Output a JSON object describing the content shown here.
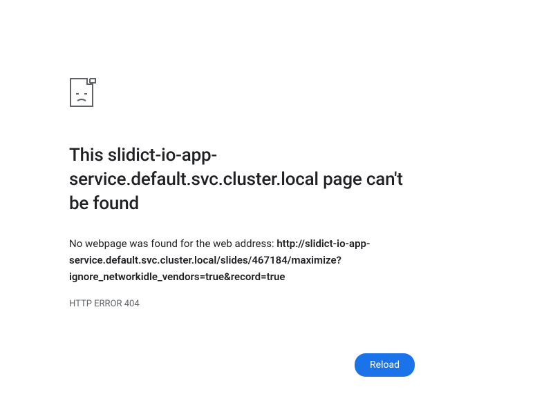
{
  "icon": {
    "name": "sad-document-icon"
  },
  "heading": {
    "prefix": "This ",
    "host": "slidict-io-app-service.default.svc.cluster.local",
    "suffix": " page can't be found"
  },
  "description": {
    "prefix": "No webpage was found for the web address: ",
    "url": "http://slidict-io-app-service.default.svc.cluster.local/slides/467184/maximize?ignore_networkidle_vendors=true&record=true"
  },
  "error_code": "HTTP ERROR 404",
  "reload_label": "Reload"
}
